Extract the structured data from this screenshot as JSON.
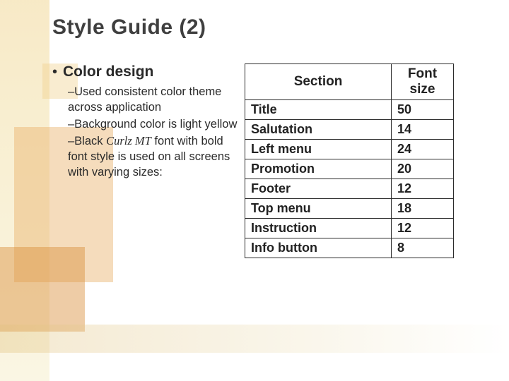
{
  "title": "Style Guide (2)",
  "bullet": {
    "label": "Color design",
    "subs": [
      "–Used consistent color theme across application",
      "–Background color is light yellow",
      "–Black Curlz MT font with bold font style is used on all screens with varying sizes:"
    ],
    "curlz_phrase": "Curlz MT"
  },
  "table": {
    "headers": [
      "Section",
      "Font size"
    ],
    "rows": [
      {
        "section": "Title",
        "size": "50"
      },
      {
        "section": "Salutation",
        "size": "14"
      },
      {
        "section": "Left menu",
        "size": "24"
      },
      {
        "section": "Promotion",
        "size": "20"
      },
      {
        "section": "Footer",
        "size": "12"
      },
      {
        "section": "Top menu",
        "size": "18"
      },
      {
        "section": "Instruction",
        "size": "12"
      },
      {
        "section": "Info button",
        "size": "8"
      }
    ]
  },
  "chart_data": {
    "type": "table",
    "title": "Font sizes by section",
    "columns": [
      "Section",
      "Font size"
    ],
    "rows": [
      [
        "Title",
        50
      ],
      [
        "Salutation",
        14
      ],
      [
        "Left menu",
        24
      ],
      [
        "Promotion",
        20
      ],
      [
        "Footer",
        12
      ],
      [
        "Top menu",
        18
      ],
      [
        "Instruction",
        12
      ],
      [
        "Info button",
        8
      ]
    ]
  }
}
